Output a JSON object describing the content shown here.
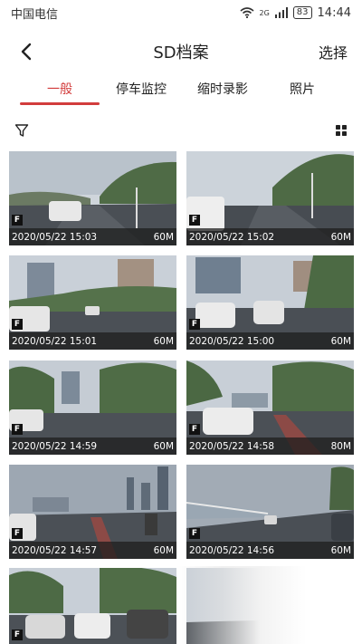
{
  "status": {
    "carrier": "中国电信",
    "network": "2G",
    "battery": "83",
    "time": "14:44"
  },
  "header": {
    "title": "SD档案",
    "select_label": "选择"
  },
  "tabs": [
    {
      "label": "一般",
      "active": true
    },
    {
      "label": "停车监控",
      "active": false
    },
    {
      "label": "缩时录影",
      "active": false
    },
    {
      "label": "照片",
      "active": false
    }
  ],
  "toolbar": {
    "filter_icon": "filter-icon",
    "view_icon": "grid-view-icon"
  },
  "files": [
    {
      "badge": "F",
      "datetime": "2020/05/22 15:03",
      "size": "60M"
    },
    {
      "badge": "F",
      "datetime": "2020/05/22 15:02",
      "size": "60M"
    },
    {
      "badge": "F",
      "datetime": "2020/05/22 15:01",
      "size": "60M"
    },
    {
      "badge": "F",
      "datetime": "2020/05/22 15:00",
      "size": "60M"
    },
    {
      "badge": "F",
      "datetime": "2020/05/22 14:59",
      "size": "60M"
    },
    {
      "badge": "F",
      "datetime": "2020/05/22 14:58",
      "size": "80M"
    },
    {
      "badge": "F",
      "datetime": "2020/05/22 14:57",
      "size": "60M"
    },
    {
      "badge": "F",
      "datetime": "2020/05/22 14:56",
      "size": "60M"
    },
    {
      "badge": "F",
      "datetime": "",
      "size": ""
    },
    {
      "badge": "",
      "datetime": "",
      "size": ""
    }
  ],
  "colors": {
    "accent": "#d23c3c"
  }
}
